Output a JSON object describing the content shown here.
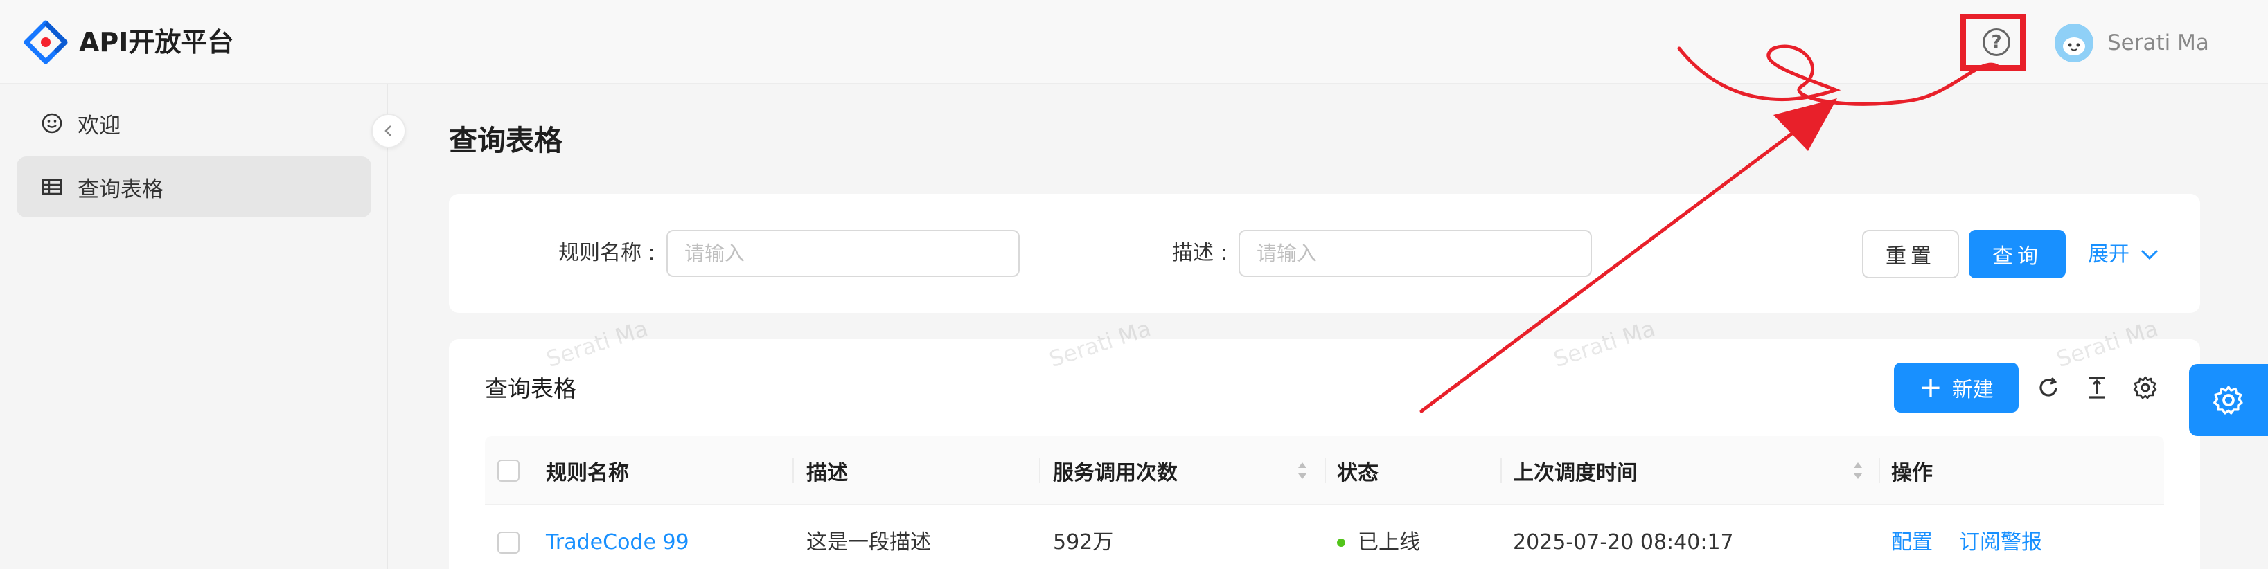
{
  "header": {
    "app_title": "API开放平台",
    "user_name": "Serati Ma",
    "icons": {
      "logo": "ant-design-logo",
      "help": "question-circle-icon",
      "avatar": "user-avatar"
    }
  },
  "sidebar": {
    "items": [
      {
        "label": "欢迎",
        "icon": "smile-icon",
        "active": false
      },
      {
        "label": "查询表格",
        "icon": "table-icon",
        "active": true
      }
    ]
  },
  "page": {
    "title": "查询表格"
  },
  "search_form": {
    "fields": [
      {
        "label": "规则名称 :",
        "placeholder": "请输入",
        "value": ""
      },
      {
        "label": "描述 :",
        "placeholder": "请输入",
        "value": ""
      }
    ],
    "reset_label": "重置",
    "query_label": "查询",
    "expand_label": "展开"
  },
  "table": {
    "title": "查询表格",
    "new_label": "新建",
    "columns": [
      "规则名称",
      "描述",
      "服务调用次数",
      "状态",
      "上次调度时间",
      "操作"
    ],
    "rows": [
      {
        "name": "TradeCode 99",
        "desc": "这是一段描述",
        "calls": "592万",
        "status": "已上线",
        "last_time": "2025-07-20 08:40:17",
        "actions": [
          "配置",
          "订阅警报"
        ]
      }
    ]
  },
  "watermark": "Serati Ma",
  "colors": {
    "primary": "#1890ff",
    "status_online": "#52c41a",
    "annotation": "#e8202a"
  }
}
